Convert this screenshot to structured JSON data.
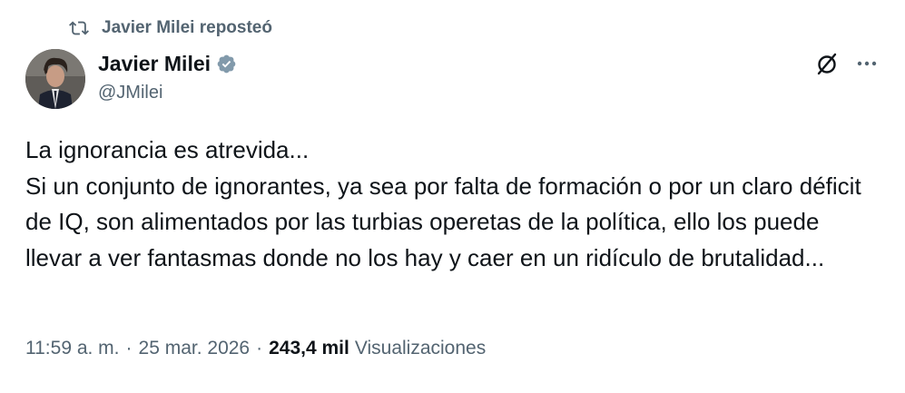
{
  "repost": {
    "icon": "repost-icon",
    "text": "Javier Milei reposteó"
  },
  "author": {
    "name": "Javier Milei",
    "handle": "@JMilei",
    "avatar_icon": "avatar",
    "verified_icon": "verified-badge-icon"
  },
  "actions": {
    "grok_icon": "grok-icon",
    "more_icon": "more-icon"
  },
  "tweet": {
    "text": "La ignorancia es atrevida...\nSi un conjunto de ignorantes, ya sea por falta de formación o por un claro déficit de IQ, son alimentados por las turbias operetas de la política, ello los puede llevar a ver fantasmas donde no los hay y caer en un ridículo de brutalidad..."
  },
  "meta": {
    "time": "11:59 a. m.",
    "separator": "·",
    "date": "25 mar. 2026",
    "views_count": "243,4 mil",
    "views_label": "Visualizaciones"
  },
  "colors": {
    "text_primary": "#0f1419",
    "text_secondary": "#536471",
    "verified": "#829aab"
  }
}
